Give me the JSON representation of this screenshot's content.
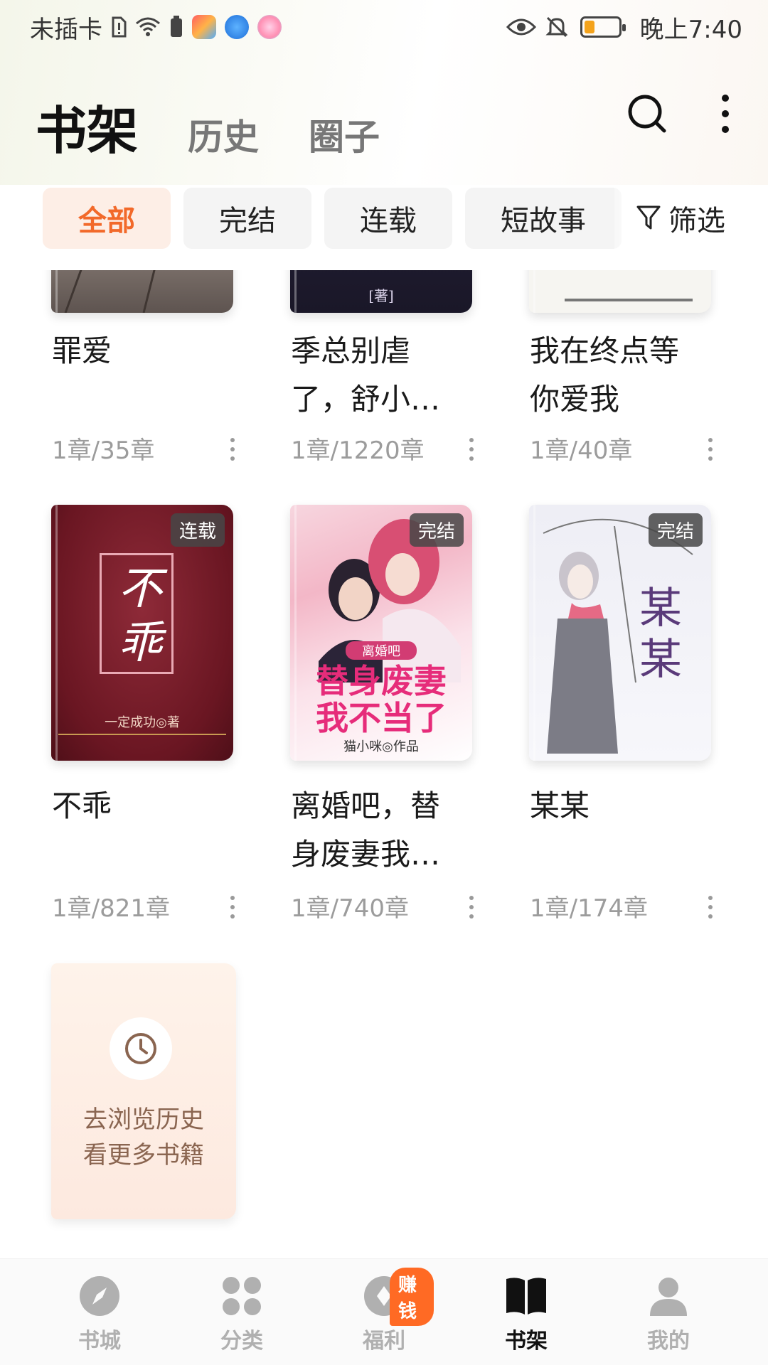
{
  "status_bar": {
    "carrier": "未插卡",
    "time": "晚上7:40"
  },
  "header": {
    "tabs": [
      {
        "label": "书架",
        "active": true
      },
      {
        "label": "历史",
        "active": false
      },
      {
        "label": "圈子",
        "active": false
      }
    ],
    "icons": [
      "search-icon",
      "more-vertical-icon"
    ]
  },
  "filters": {
    "chips": [
      {
        "label": "全部",
        "active": true
      },
      {
        "label": "完结",
        "active": false
      },
      {
        "label": "连载",
        "active": false
      },
      {
        "label": "短故事",
        "active": false
      }
    ],
    "filter_label": "筛选"
  },
  "books": [
    {
      "title": "罪爱",
      "progress": "1章/35章"
    },
    {
      "title": "季总别虐了，舒小…",
      "progress": "1章/1220章",
      "cover_text": "[著]"
    },
    {
      "title": "我在终点等你爱我",
      "progress": "1章/40章"
    },
    {
      "title": "不乖",
      "progress": "1章/821章",
      "badge": "连载",
      "cover_title": "不乖",
      "cover_author": "一定成功◎著"
    },
    {
      "title": "离婚吧，替身废妻我…",
      "progress": "1章/740章",
      "badge": "完结",
      "cover_tag": "离婚吧",
      "cover_line1": "替身废妻",
      "cover_line2": "我不当了",
      "cover_author": "猫小咪◎作品"
    },
    {
      "title": "某某",
      "progress": "1章/174章",
      "badge": "完结",
      "cover_title": "某某"
    }
  ],
  "history_card": {
    "line1": "去浏览历史",
    "line2": "看更多书籍"
  },
  "bottom_nav": {
    "items": [
      {
        "label": "书城",
        "icon": "compass-icon"
      },
      {
        "label": "分类",
        "icon": "grid-icon"
      },
      {
        "label": "福利",
        "icon": "gift-icon",
        "badge": "赚钱"
      },
      {
        "label": "书架",
        "icon": "book-icon",
        "active": true
      },
      {
        "label": "我的",
        "icon": "user-icon"
      }
    ]
  },
  "colors": {
    "accent": "#f2692a",
    "chip_active_bg": "#fdeee6",
    "badge_bg": "#ff6a24"
  }
}
